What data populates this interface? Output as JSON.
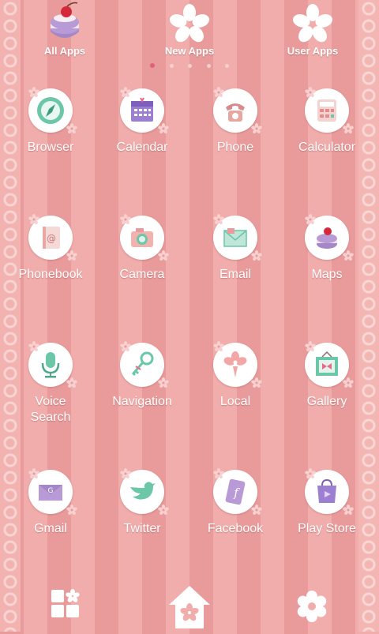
{
  "top_bar": {
    "items": [
      {
        "label": "All Apps",
        "icon": "macaron-icon"
      },
      {
        "label": "New Apps",
        "icon": "cherry-blossom-icon"
      },
      {
        "label": "User Apps",
        "icon": "cherry-blossom-icon"
      }
    ],
    "page_count": 5,
    "active_page": 1
  },
  "apps": [
    {
      "label": "Browser",
      "icon": "compass-icon"
    },
    {
      "label": "Calendar",
      "icon": "calendar-icon"
    },
    {
      "label": "Phone",
      "icon": "phone-icon"
    },
    {
      "label": "Calculator",
      "icon": "calculator-icon"
    },
    {
      "label": "Phonebook",
      "icon": "phonebook-icon"
    },
    {
      "label": "Camera",
      "icon": "camera-icon"
    },
    {
      "label": "Email",
      "icon": "envelope-icon"
    },
    {
      "label": "Maps",
      "icon": "macaron-icon"
    },
    {
      "label": "Voice\nSearch",
      "icon": "microphone-icon"
    },
    {
      "label": "Navigation",
      "icon": "key-icon"
    },
    {
      "label": "Local",
      "icon": "flower-pin-icon"
    },
    {
      "label": "Gallery",
      "icon": "picture-frame-icon"
    },
    {
      "label": "Gmail",
      "icon": "envelope-g-icon"
    },
    {
      "label": "Twitter",
      "icon": "bird-icon"
    },
    {
      "label": "Facebook",
      "icon": "facebook-card-icon"
    },
    {
      "label": "Play Store",
      "icon": "shopping-bag-icon"
    }
  ],
  "dock": {
    "left": {
      "icon": "app-drawer-icon"
    },
    "center": {
      "icon": "home-flower-icon"
    },
    "right": {
      "icon": "settings-flower-icon"
    }
  },
  "colors": {
    "stripe_dark": "#e99a9a",
    "stripe_light": "#f0adab",
    "accent_purple": "#a07ad0",
    "accent_mint": "#6cc6a8"
  }
}
